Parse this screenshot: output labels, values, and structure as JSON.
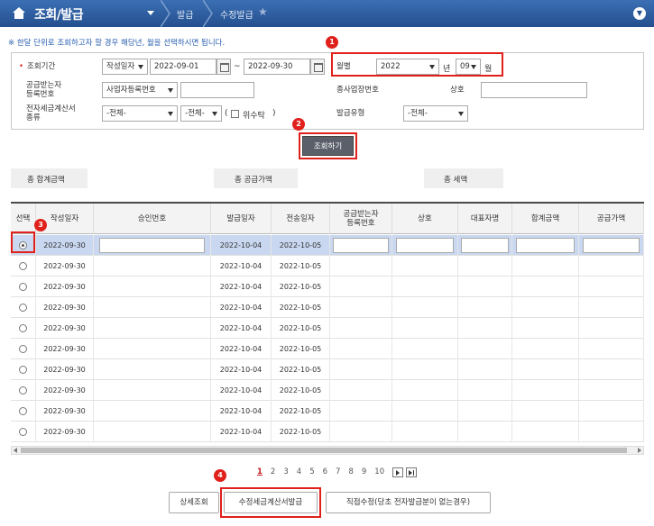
{
  "header": {
    "title": "조회/발급",
    "crumbs": [
      "발급",
      "수정발급"
    ]
  },
  "notice": "※ 한달 단위로 조회하고자 할 경우 해당년, 월을 선택하시면 됩니다.",
  "search": {
    "period_label": "조회기간",
    "period_type": "작성일자",
    "date_from": "2022-09-01",
    "tilde": "~",
    "date_to": "2022-09-30",
    "monthly_label": "월별",
    "year": "2022",
    "year_unit": "년",
    "month": "09",
    "month_unit": "월",
    "supplier_reg_label_1": "공급받는자",
    "supplier_reg_label_2": "등록번호",
    "reg_type": "사업자등록번호",
    "reg_value": "",
    "branch_label": "종사업장번호",
    "company_label": "상호",
    "company_value": "",
    "invoice_kind_label_1": "전자세금계산서",
    "invoice_kind_label_2": "종류",
    "kind1": "-전체-",
    "kind2": "-전체-",
    "paren_open": "(",
    "consign_label": "위수탁",
    "paren_close": ")",
    "issue_type_label": "발급유형",
    "issue_type": "-전체-",
    "search_button": "조회하기"
  },
  "totals": {
    "total_sum": "총 합계금액",
    "total_supply": "총 공급가액",
    "total_tax": "총 세액"
  },
  "badges": [
    "1",
    "2",
    "3",
    "4"
  ],
  "grid": {
    "columns": [
      "선택",
      "작성일자",
      "승인번호",
      "발급일자",
      "전송일자",
      "공급받는자\n등록번호",
      "상호",
      "대표자명",
      "합계금액",
      "공급가액"
    ],
    "rows": [
      {
        "written": "2022-09-30",
        "issued": "2022-10-04",
        "sent": "2022-10-05"
      },
      {
        "written": "2022-09-30",
        "issued": "2022-10-04",
        "sent": "2022-10-05"
      },
      {
        "written": "2022-09-30",
        "issued": "2022-10-04",
        "sent": "2022-10-05"
      },
      {
        "written": "2022-09-30",
        "issued": "2022-10-04",
        "sent": "2022-10-05"
      },
      {
        "written": "2022-09-30",
        "issued": "2022-10-04",
        "sent": "2022-10-05"
      },
      {
        "written": "2022-09-30",
        "issued": "2022-10-04",
        "sent": "2022-10-05"
      },
      {
        "written": "2022-09-30",
        "issued": "2022-10-04",
        "sent": "2022-10-05"
      },
      {
        "written": "2022-09-30",
        "issued": "2022-10-04",
        "sent": "2022-10-05"
      },
      {
        "written": "2022-09-30",
        "issued": "2022-10-04",
        "sent": "2022-10-05"
      },
      {
        "written": "2022-09-30",
        "issued": "2022-10-04",
        "sent": "2022-10-05"
      }
    ]
  },
  "pager": {
    "pages": [
      "1",
      "2",
      "3",
      "4",
      "5",
      "6",
      "7",
      "8",
      "9",
      "10"
    ],
    "current": "1"
  },
  "buttons": {
    "detail": "상세조회",
    "amend_issue": "수정세금계산서발급",
    "direct_amend": "직접수정(당초 전자발급분이 없는경우)"
  },
  "colors": {
    "header_blue": "#2b5a9c",
    "highlight_red": "#e0211b",
    "selected_row": "#c9d8f0"
  }
}
